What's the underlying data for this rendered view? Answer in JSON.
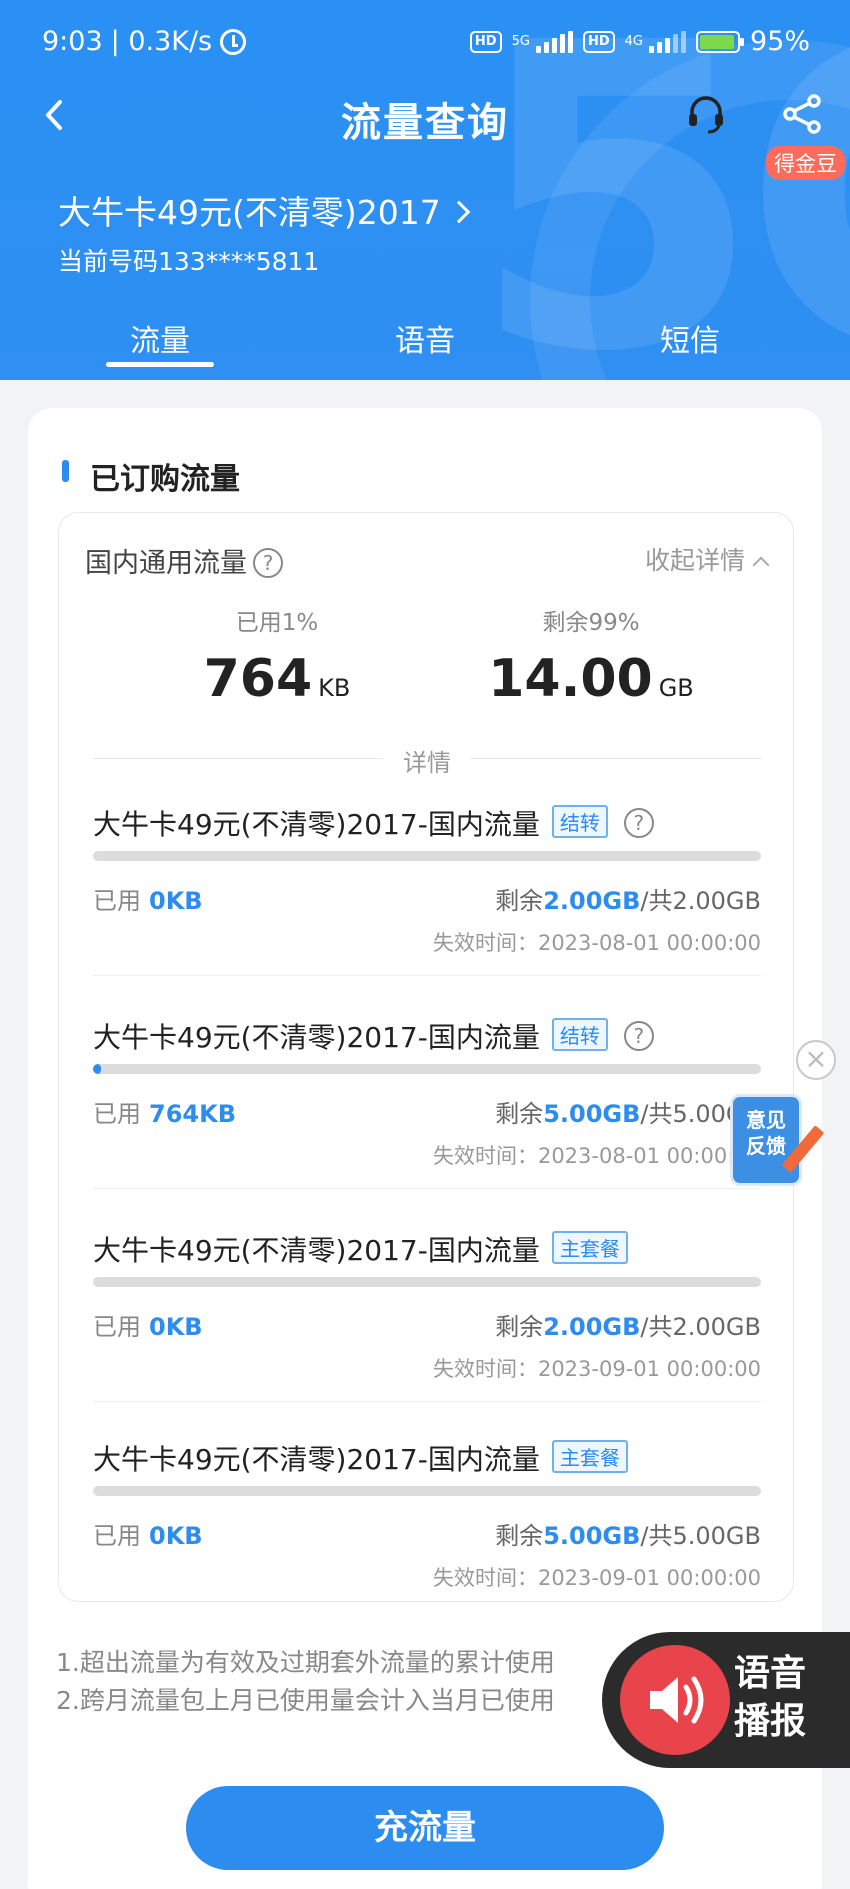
{
  "status_bar": {
    "time": "9:03",
    "speed": "| 0.3K/s",
    "net1_hd": "HD",
    "net1_type": "5G",
    "net2_hd": "HD",
    "net2_type": "4G",
    "battery": "95%",
    "battery_level": 0.95
  },
  "nav": {
    "title": "流量查询",
    "coin_badge": "得金豆"
  },
  "plan": {
    "name": "大牛卡49元(不清零)2017",
    "phone": "当前号码133****5811"
  },
  "tabs": [
    {
      "label": "流量",
      "active": true
    },
    {
      "label": "语音",
      "active": false
    },
    {
      "label": "短信",
      "active": false
    }
  ],
  "section": {
    "title": "已订购流量"
  },
  "summary": {
    "title": "国内通用流量",
    "help": "?",
    "collapse": "收起详情",
    "used_label": "已用1%",
    "used_value": "764",
    "used_unit": "KB",
    "remain_label": "剩余99%",
    "remain_value": "14.00",
    "remain_unit": "GB",
    "details_label": "详情"
  },
  "items": [
    {
      "title": "大牛卡49元(不清零)2017-国内流量",
      "tag": "结转",
      "help": "?",
      "progress": 0.0,
      "used_label": "已用",
      "used": "0KB",
      "remain_prefix": "剩余",
      "remain": "2.00GB",
      "total": "/共2.00GB",
      "expire": "失效时间：2023-08-01 00:00:00"
    },
    {
      "title": "大牛卡49元(不清零)2017-国内流量",
      "tag": "结转",
      "help": "?",
      "progress": 0.0001,
      "used_label": "已用",
      "used": "764KB",
      "remain_prefix": "剩余",
      "remain": "5.00GB",
      "total": "/共5.00GB",
      "expire": "失效时间：2023-08-01 00:00:00"
    },
    {
      "title": "大牛卡49元(不清零)2017-国内流量",
      "tag": "主套餐",
      "progress": 0.0,
      "used_label": "已用",
      "used": "0KB",
      "remain_prefix": "剩余",
      "remain": "2.00GB",
      "total": "/共2.00GB",
      "expire": "失效时间：2023-09-01 00:00:00"
    },
    {
      "title": "大牛卡49元(不清零)2017-国内流量",
      "tag": "主套餐",
      "progress": 0.0,
      "used_label": "已用",
      "used": "0KB",
      "remain_prefix": "剩余",
      "remain": "5.00GB",
      "total": "/共5.00GB",
      "expire": "失效时间：2023-09-01 00:00:00"
    }
  ],
  "notes": [
    "1.超出流量为有效及过期套外流量的累计使用",
    "2.跨月流量包上月已使用量会计入当月已使用"
  ],
  "recharge_button": "充流量",
  "feedback": {
    "line1": "意见",
    "line2": "反馈",
    "close": "×"
  },
  "voice": {
    "line1": "语音",
    "line2": "播报"
  },
  "colors": {
    "brand": "#2d8cf0",
    "header": "#2f8ff2",
    "voice_red": "#e9444b"
  }
}
